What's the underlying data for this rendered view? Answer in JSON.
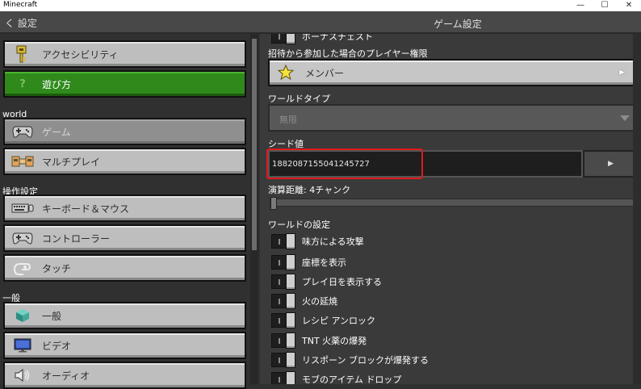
{
  "window": {
    "title": "Minecraft",
    "minimize": "—",
    "maximize": "☐",
    "close": "✕"
  },
  "header": {
    "back_label": "く 設定",
    "title": "ゲーム設定"
  },
  "sidebar": {
    "items": [
      {
        "label": "アクセシビリティ",
        "icon": "key-icon"
      },
      {
        "label": "遊び方",
        "icon": "question-icon",
        "selected": true
      }
    ],
    "section_world": "world",
    "world_items": [
      {
        "label": "ゲーム",
        "icon": "controller-icon",
        "selected": true
      },
      {
        "label": "マルチプレイ",
        "icon": "multiplayer-icon"
      }
    ],
    "section_controls": "操作設定",
    "control_items": [
      {
        "label": "キーボード＆マウス",
        "icon": "keyboard-icon"
      },
      {
        "label": "コントローラー",
        "icon": "controller-icon"
      },
      {
        "label": "タッチ",
        "icon": "touch-icon"
      }
    ],
    "section_general": "一般",
    "general_items": [
      {
        "label": "一般",
        "icon": "cube-icon"
      },
      {
        "label": "ビデオ",
        "icon": "monitor-icon"
      },
      {
        "label": "オーディオ",
        "icon": "speaker-icon"
      }
    ]
  },
  "main": {
    "cut_top_label": "ボーナスチェスト",
    "invite_permission_label": "招待から参加した場合のプレイヤー権限",
    "invite_permission_value": "メンバー",
    "world_type_label": "ワールドタイプ",
    "world_type_value": "無限",
    "seed_label": "シード値",
    "seed_value": "1882087155041245727",
    "sim_distance_label": "演算距離: 4チャンク",
    "sim_distance_value": 4,
    "world_settings_label": "ワールドの設定",
    "toggles": [
      {
        "label": "味方による攻撃",
        "on": false
      },
      {
        "label": "座標を表示",
        "on": false
      },
      {
        "label": "プレイ日を表示する",
        "on": false
      },
      {
        "label": "火の延焼",
        "on": false
      },
      {
        "label": "レシピ アンロック",
        "on": false
      },
      {
        "label": "TNT 火薬の爆発",
        "on": false
      },
      {
        "label": "リスポーン ブロックが爆発する",
        "on": false
      },
      {
        "label": "モブのアイテム ドロップ",
        "on": false
      }
    ]
  },
  "colors": {
    "selected_green": "#2f8a1b",
    "highlight_red": "#e0191d"
  }
}
